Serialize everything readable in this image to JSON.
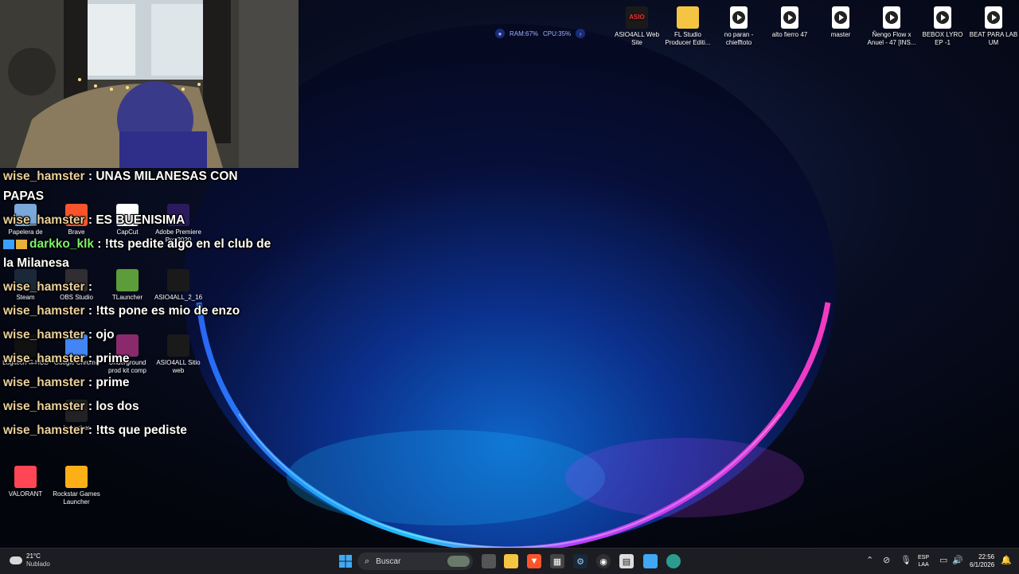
{
  "desktop_top_icons": [
    {
      "label": "ASIO4ALL Web Site",
      "icon": "asio4all-icon",
      "kind": "asio"
    },
    {
      "label": "FL Studio Producer Editi...",
      "icon": "folder-icon",
      "kind": "folder"
    },
    {
      "label": "no paran - chiefftoto",
      "icon": "media-file-icon",
      "kind": "file"
    },
    {
      "label": "alto fierro 47",
      "icon": "media-file-icon",
      "kind": "file"
    },
    {
      "label": "master",
      "icon": "media-file-icon",
      "kind": "file"
    },
    {
      "label": "Ñengo Flow x Anuel - 47 [INS...",
      "icon": "media-file-icon",
      "kind": "file"
    },
    {
      "label": "BEBOX LYRO EP -1",
      "icon": "media-file-icon",
      "kind": "file"
    },
    {
      "label": "BEAT PARA LAB UM",
      "icon": "media-file-icon",
      "kind": "file"
    }
  ],
  "desktop_left_icons": [
    {
      "label": "Papelera de",
      "icon": "recycle-bin-icon",
      "color": "#7aa8d8"
    },
    {
      "label": "Brave",
      "icon": "brave-icon",
      "color": "#fb542b"
    },
    {
      "label": "CapCut",
      "icon": "capcut-icon",
      "color": "#ffffff"
    },
    {
      "label": "Adobe Premiere Pro 2020",
      "icon": "premiere-icon",
      "color": "#2a1b5e"
    },
    {
      "label": "Steam",
      "icon": "steam-icon",
      "color": "#1b2838"
    },
    {
      "label": "OBS Studio",
      "icon": "obs-icon",
      "color": "#302e31"
    },
    {
      "label": "TLauncher",
      "icon": "minecraft-icon",
      "color": "#5d9c3a"
    },
    {
      "label": "ASIO4ALL_2_16",
      "icon": "asio4all-icon",
      "color": "#1a1a1a"
    },
    {
      "label": "Logitech G HUB",
      "icon": "logitech-icon",
      "color": "#111111"
    },
    {
      "label": "Google Chrome",
      "icon": "chrome-icon",
      "color": "#4285f4"
    },
    {
      "label": "Underground prod kit comp",
      "icon": "winrar-icon",
      "color": "#8a2a6c"
    },
    {
      "label": "ASIO4ALL Sitio web",
      "icon": "asio4all-icon",
      "color": "#1a1a1a"
    },
    {
      "label": "Launcher",
      "icon": "epic-games-icon",
      "color": "#222222"
    },
    {
      "label": "VALORANT",
      "icon": "valorant-icon",
      "color": "#ff4655"
    },
    {
      "label": "Rockstar Games Launcher",
      "icon": "rockstar-icon",
      "color": "#fcaf17"
    }
  ],
  "perf_widget": {
    "ram": "RAM:67%",
    "cpu": "CPU:35%"
  },
  "chat": [
    {
      "user": "wise_hamster",
      "sep": " : ",
      "msg": "UNAS MILANESAS CON",
      "badges": false
    },
    {
      "user": "",
      "sep": "",
      "msg": "PAPAS",
      "badges": false
    },
    {
      "user": "wise_hamster",
      "sep": " : ",
      "msg": "ES BUENISIMA",
      "badges": false
    },
    {
      "user": "darkko_klk",
      "sep": " : ",
      "msg": "!tts pedite algo en el club de",
      "badges": true
    },
    {
      "user": "",
      "sep": "",
      "msg": "la Milanesa",
      "badges": false
    },
    {
      "user": "wise_hamster",
      "sep": " : ",
      "msg": "",
      "badges": false
    },
    {
      "user": "wise_hamster",
      "sep": " : ",
      "msg": "!tts pone es mio de enzo",
      "badges": false
    },
    {
      "user": "wise_hamster",
      "sep": " : ",
      "msg": "ojo",
      "badges": false
    },
    {
      "user": "wise_hamster",
      "sep": " : ",
      "msg": "prime",
      "badges": false
    },
    {
      "user": "wise_hamster",
      "sep": " : ",
      "msg": "prime",
      "badges": false
    },
    {
      "user": "wise_hamster",
      "sep": " : ",
      "msg": "los dos",
      "badges": false
    },
    {
      "user": "wise_hamster",
      "sep": " : ",
      "msg": "!tts que pediste",
      "badges": false
    }
  ],
  "taskbar": {
    "weather_temp": "21°C",
    "weather_desc": "Nublado",
    "search_placeholder": "Buscar",
    "lang_1": "ESP",
    "lang_2": "LAA",
    "time": "22:56",
    "date": "6/1/2026"
  }
}
